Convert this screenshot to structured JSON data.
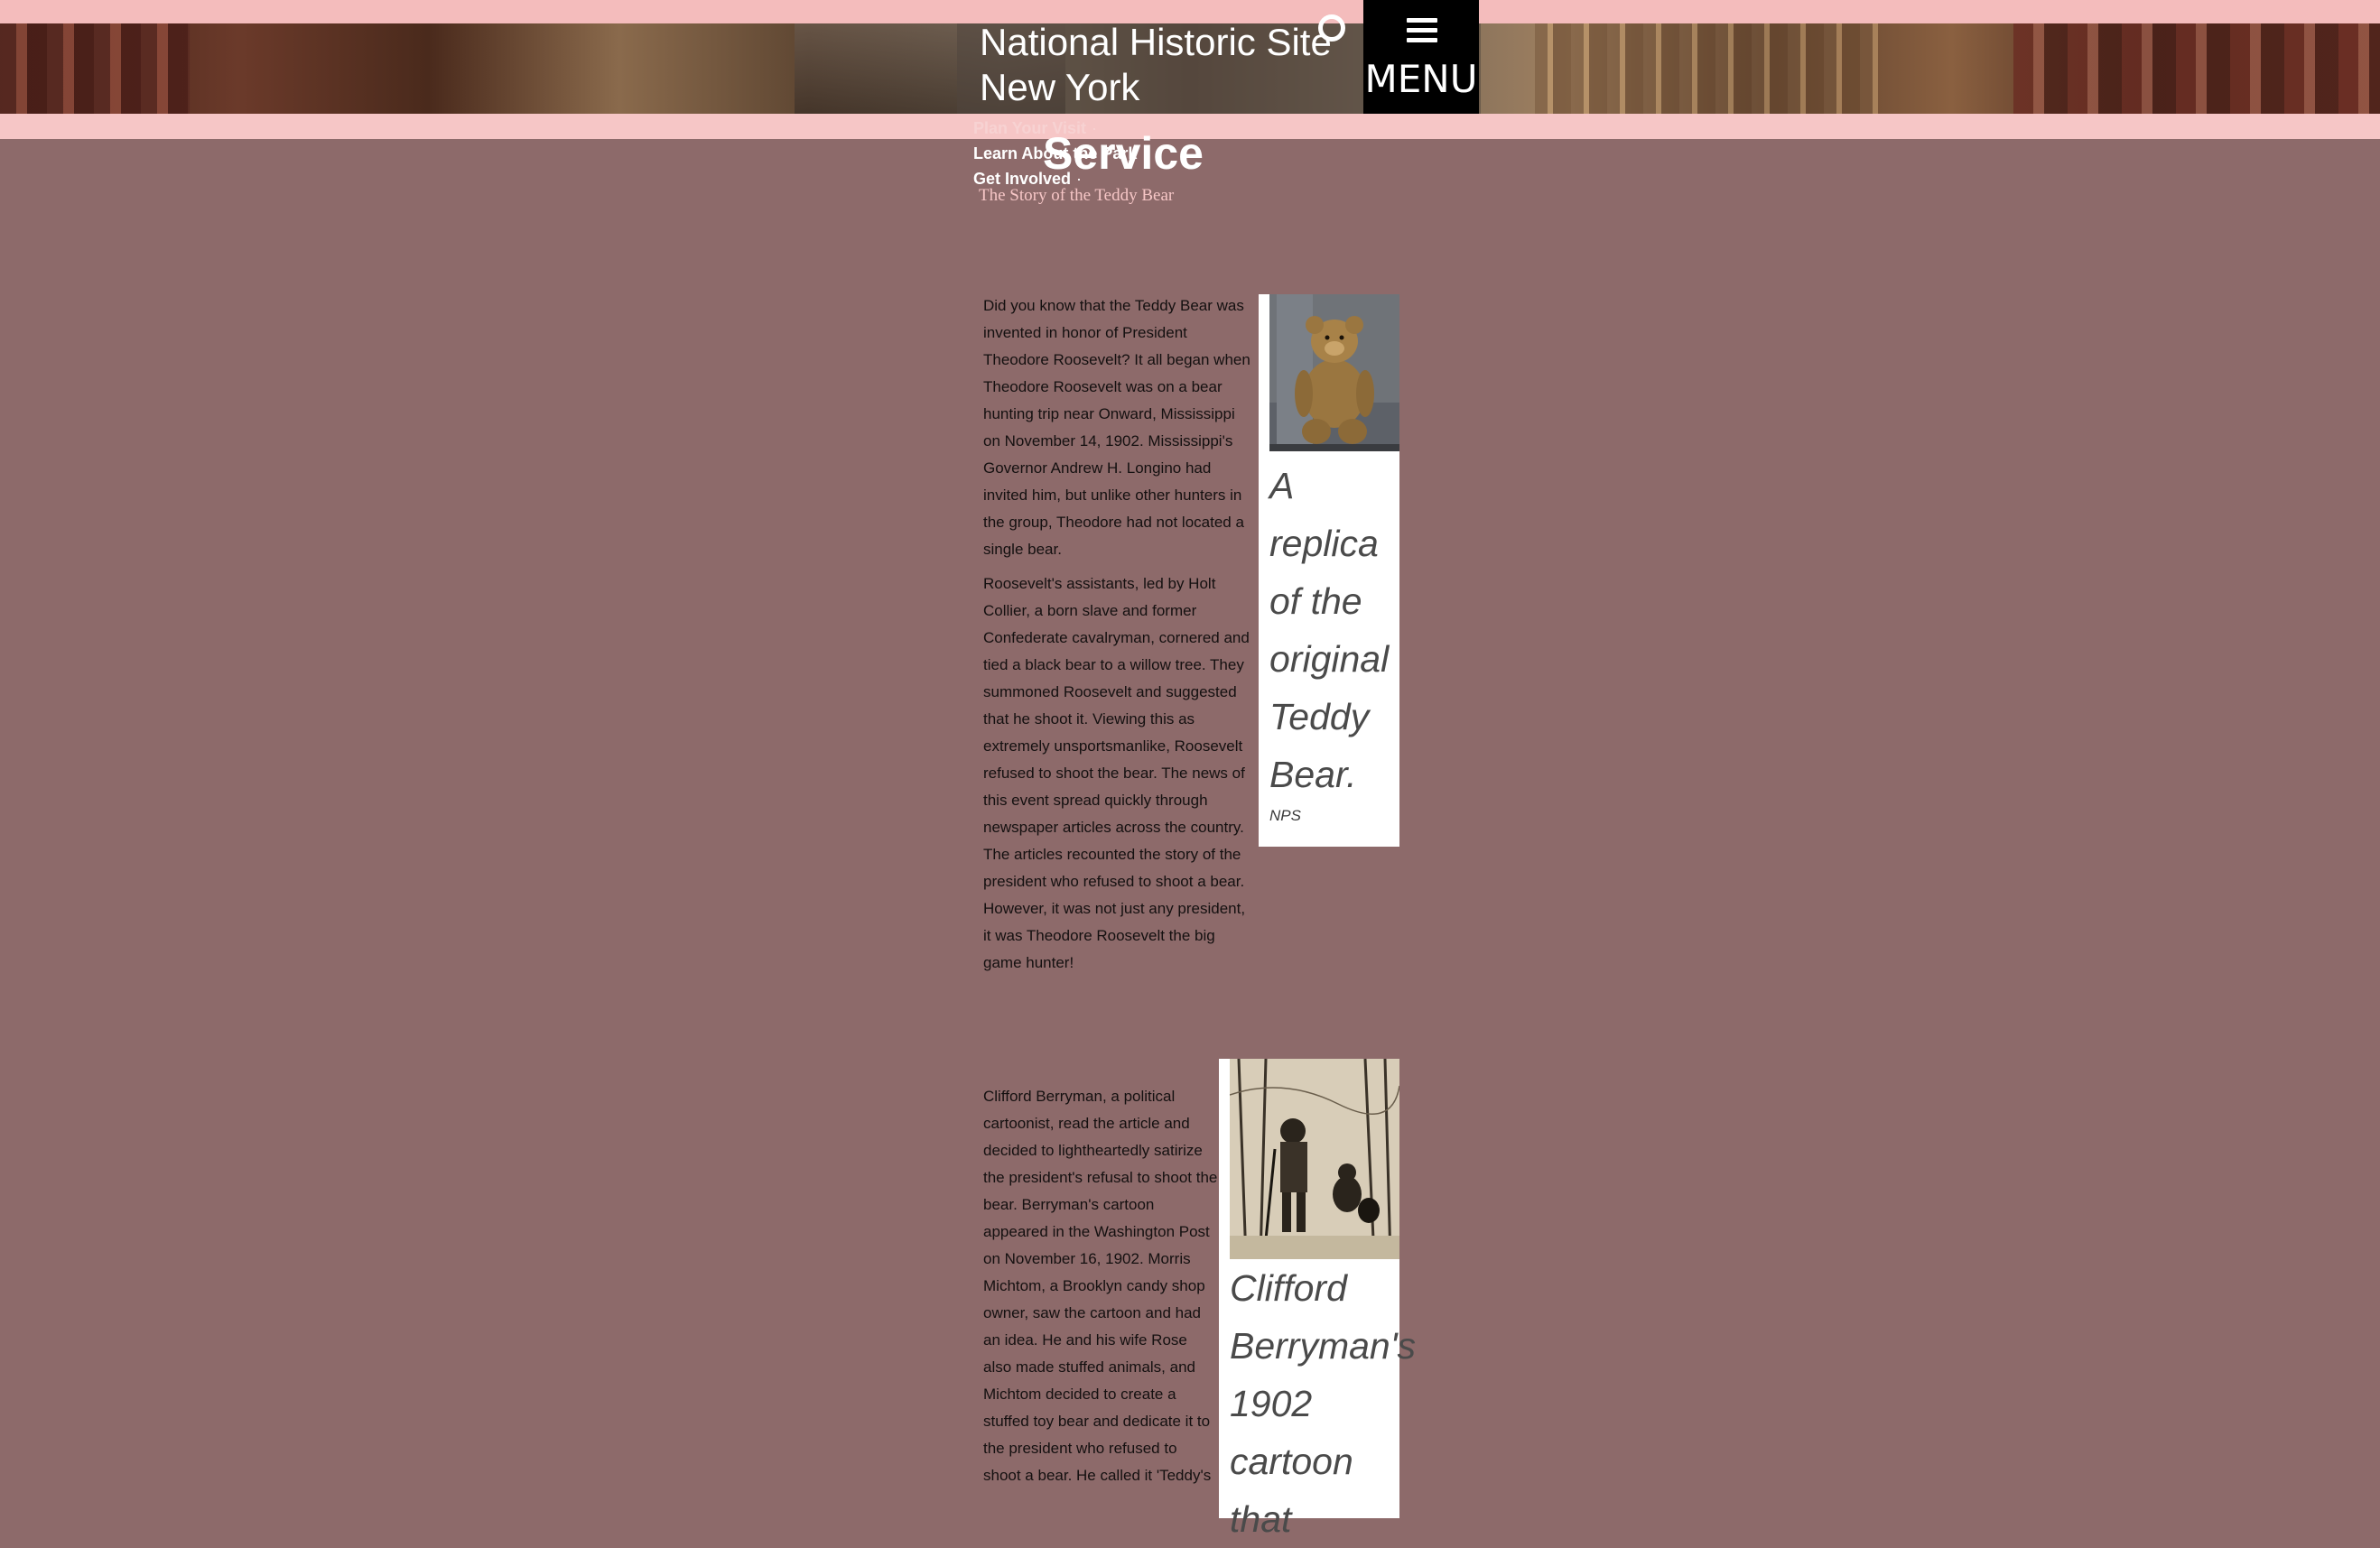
{
  "header": {
    "site_title": "National Historic Site\nNew York",
    "menu_label": "MENU",
    "overlap_title": "Service",
    "nav": [
      {
        "label": "Plan Your Visit",
        "dot": "·"
      },
      {
        "label": "Learn About the Park",
        "dot": "·"
      },
      {
        "label": "Get Involved",
        "dot": "·"
      }
    ],
    "breadcrumb": "The Story of the Teddy Bear"
  },
  "article": {
    "para1": "Did you know that the Teddy Bear was invented in honor of President Theodore Roosevelt? It all began when Theodore Roosevelt was on a bear hunting trip near Onward, Mississippi on November 14, 1902. Mississippi's Governor Andrew H. Longino had invited him, but unlike other hunters in the group, Theodore had not located a single bear.",
    "para2": "Roosevelt's assistants, led by Holt Collier, a born slave and former Confederate cavalryman, cornered and tied a black bear to a willow tree. They summoned Roosevelt and suggested that he shoot it. Viewing this as extremely unsportsmanlike, Roosevelt refused to shoot the bear. The news of this event spread quickly through newspaper articles across the country. The articles recounted the story of the president who refused to shoot a bear. However, it was not just any president, it was Theodore Roosevelt the big game hunter!",
    "para3": "Clifford Berryman, a political cartoonist, read the article and decided to lightheartedly satirize the president's refusal to shoot the bear. Berryman's cartoon appeared in the Washington Post on November 16, 1902. Morris Michtom, a Brooklyn candy shop owner, saw the cartoon and had an idea. He and his wife Rose also made stuffed animals, and Michtom decided to create a stuffed toy bear and dedicate it to the president who refused to shoot a bear. He called it 'Teddy's"
  },
  "figures": [
    {
      "caption": "A replica of the original Teddy Bear.",
      "credit": "NPS",
      "image": "teddy-bear-photo"
    },
    {
      "caption": "Clifford Berryman's 1902 cartoon that",
      "credit": "",
      "image": "berryman-cartoon"
    }
  ],
  "colors": {
    "background": "#8d6a6a",
    "top_bar": "#f4bcbc",
    "menu_bg": "#000000",
    "breadcrumb": "#f6c6c6"
  }
}
